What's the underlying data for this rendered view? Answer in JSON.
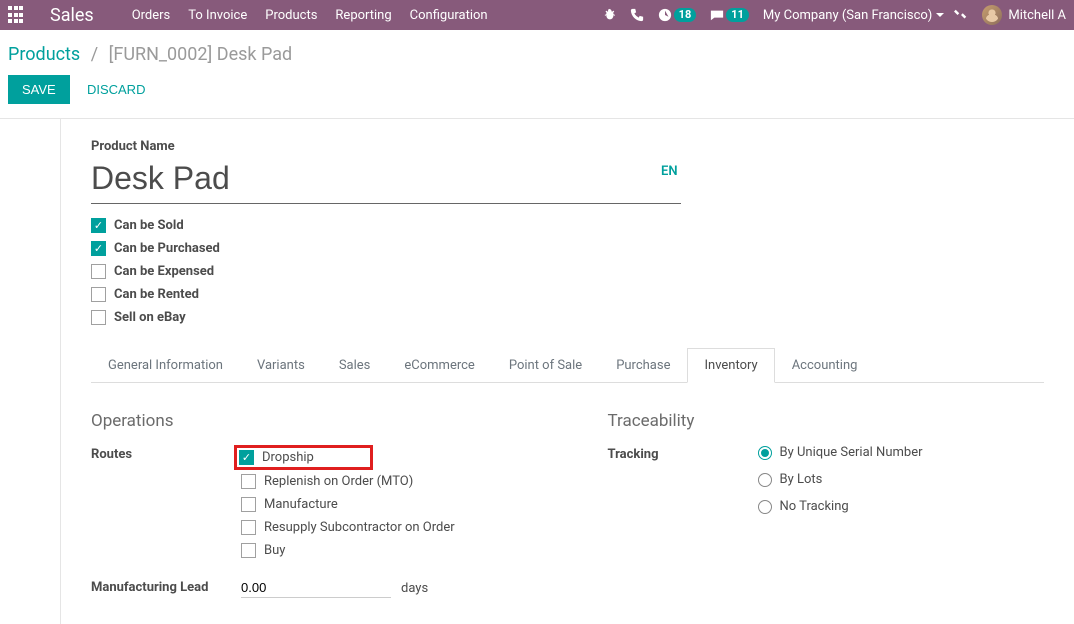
{
  "topbar": {
    "brand": "Sales",
    "nav": [
      "Orders",
      "To Invoice",
      "Products",
      "Reporting",
      "Configuration"
    ],
    "activity_badge": "18",
    "chat_badge": "11",
    "company": "My Company (San Francisco)",
    "user": "Mitchell A"
  },
  "breadcrumb": {
    "root": "Products",
    "current": "[FURN_0002] Desk Pad"
  },
  "actions": {
    "save": "SAVE",
    "discard": "DISCARD"
  },
  "form": {
    "product_name_label": "Product Name",
    "product_name": "Desk Pad",
    "lang": "EN",
    "checks": [
      {
        "label": "Can be Sold",
        "checked": true
      },
      {
        "label": "Can be Purchased",
        "checked": true
      },
      {
        "label": "Can be Expensed",
        "checked": false
      },
      {
        "label": "Can be Rented",
        "checked": false
      },
      {
        "label": "Sell on eBay",
        "checked": false
      }
    ],
    "tabs": [
      "General Information",
      "Variants",
      "Sales",
      "eCommerce",
      "Point of Sale",
      "Purchase",
      "Inventory",
      "Accounting"
    ],
    "active_tab": "Inventory"
  },
  "inventory": {
    "operations_title": "Operations",
    "routes_label": "Routes",
    "routes": [
      {
        "label": "Dropship",
        "checked": true,
        "highlight": true
      },
      {
        "label": "Replenish on Order (MTO)",
        "checked": false
      },
      {
        "label": "Manufacture",
        "checked": false
      },
      {
        "label": "Resupply Subcontractor on Order",
        "checked": false
      },
      {
        "label": "Buy",
        "checked": false
      }
    ],
    "mfg_lead_label": "Manufacturing Lead",
    "mfg_lead_value": "0.00",
    "mfg_lead_unit": "days",
    "traceability_title": "Traceability",
    "tracking_label": "Tracking",
    "tracking_options": [
      {
        "label": "By Unique Serial Number",
        "selected": true
      },
      {
        "label": "By Lots",
        "selected": false
      },
      {
        "label": "No Tracking",
        "selected": false
      }
    ]
  }
}
